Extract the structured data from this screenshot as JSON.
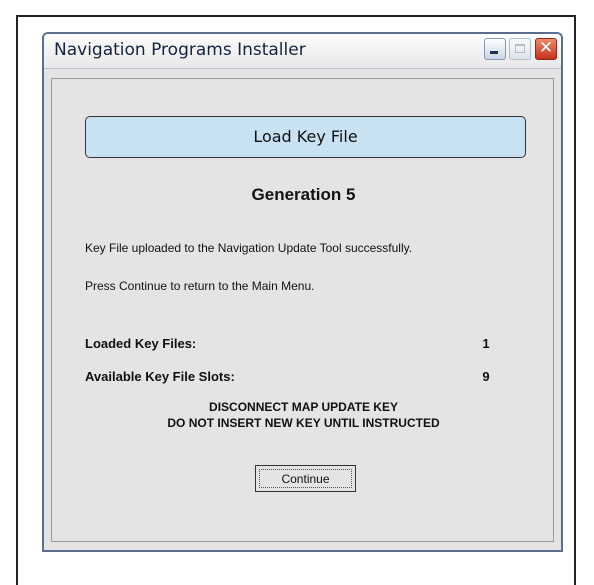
{
  "window": {
    "title": "Navigation Programs Installer",
    "controls": {
      "minimize_icon": "minimize-icon",
      "maximize_icon": "maximize-icon",
      "close_icon": "close-icon",
      "close_glyph": "✕"
    }
  },
  "panel": {
    "header_label": "Load Key File",
    "generation": "Generation 5",
    "message_1": "Key File uploaded to the Navigation Update Tool successfully.",
    "message_2": "Press Continue to return to the Main Menu.",
    "stats": [
      {
        "label": "Loaded Key Files:",
        "value": "1"
      },
      {
        "label": "Available Key File Slots:",
        "value": "9"
      }
    ],
    "warning_line_1": "DISCONNECT MAP UPDATE KEY",
    "warning_line_2": "DO NOT INSERT NEW KEY UNTIL INSTRUCTED",
    "continue_label": "Continue"
  },
  "colors": {
    "header_button_bg": "#c9e2f3",
    "panel_bg": "#e4e4e4",
    "close_button": "#c4321c"
  }
}
